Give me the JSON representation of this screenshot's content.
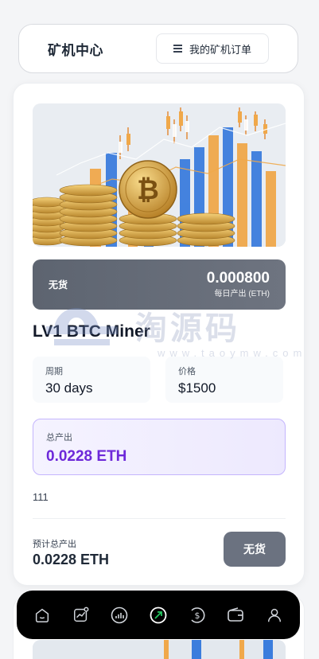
{
  "header": {
    "title": "矿机中心",
    "orders_button": "我的矿机订单"
  },
  "miner": {
    "status": "无货",
    "daily_output_value": "0.000800",
    "daily_output_label": "每日产出 (ETH)",
    "name": "LV1 BTC Miner",
    "period_label": "周期",
    "period_value": "30 days",
    "price_label": "价格",
    "price_value": "$1500",
    "total_output_label": "总产出",
    "total_output_value": "0.0228 ETH",
    "description": "111",
    "expected_label": "预计总产出",
    "expected_value": "0.0228 ETH",
    "buy_button": "无货"
  },
  "watermark": {
    "text": "淘源码",
    "url": "www.taoymw.com"
  },
  "bottom_nav": {
    "items": [
      {
        "icon": "home-icon"
      },
      {
        "icon": "market-trend-icon"
      },
      {
        "icon": "bar-chart-icon"
      },
      {
        "icon": "mining-icon",
        "active_color": "#22c55e"
      },
      {
        "icon": "dollar-coin-icon"
      },
      {
        "icon": "wallet-icon"
      },
      {
        "icon": "user-icon"
      }
    ]
  },
  "colors": {
    "status_bar": "#636a76",
    "total_value": "#6d28d9",
    "buy_button": "#6b7280",
    "nav_bg": "#000000"
  }
}
